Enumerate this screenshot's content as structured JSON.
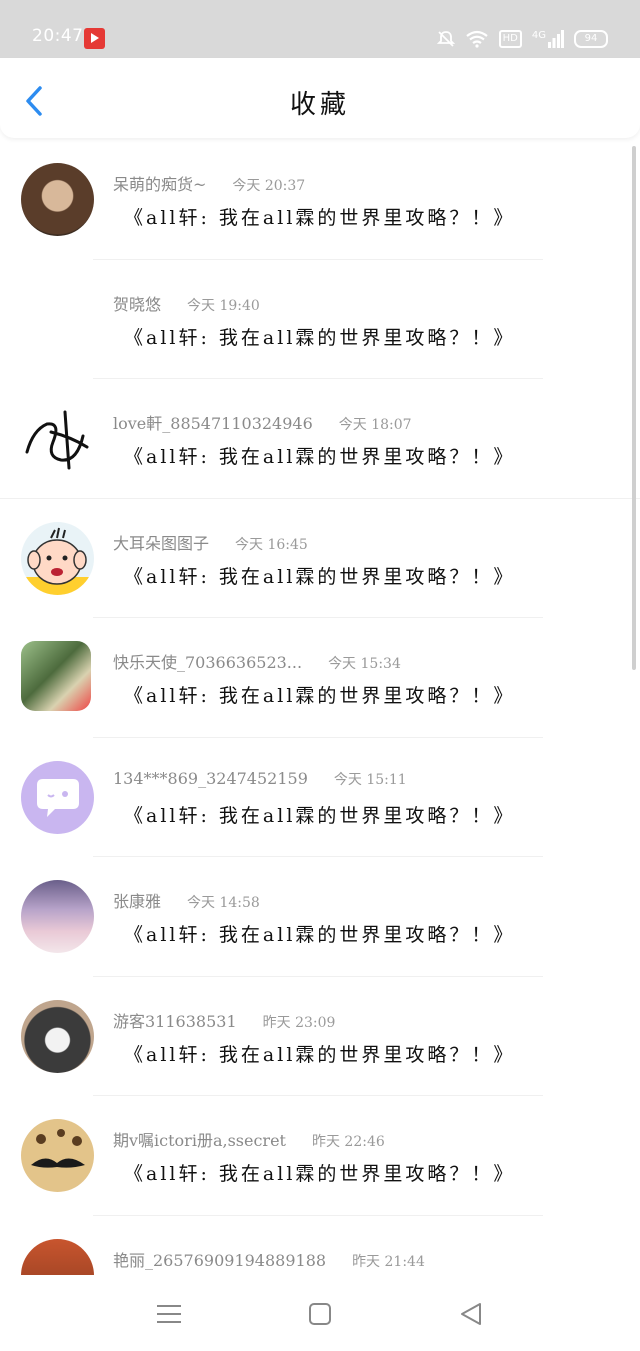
{
  "status_bar": {
    "time": "20:47",
    "hd": "HD",
    "network": "4G",
    "battery": "94"
  },
  "header": {
    "title": "收藏"
  },
  "items": [
    {
      "name": "呆萌的痴货~",
      "time": "今天 20:37",
      "title": "《all轩: 我在all霖的世界里攻略？！》",
      "avatar_color": "#8a6a4a"
    },
    {
      "name": "贺晓悠",
      "time": "今天 19:40",
      "title": "《all轩: 我在all霖的世界里攻略？！》",
      "avatar_color": "#ffffff"
    },
    {
      "name": "love軒_88547110324946",
      "time": "今天 18:07",
      "title": "《all轩: 我在all霖的世界里攻略？！》",
      "avatar_color": "#ffffff"
    },
    {
      "name": "大耳朵图图子",
      "time": "今天 16:45",
      "title": "《all轩: 我在all霖的世界里攻略？！》",
      "avatar_color": "#e9f3f7"
    },
    {
      "name": "快乐天使_7036636523...",
      "time": "今天 15:34",
      "title": "《all轩: 我在all霖的世界里攻略？！》",
      "avatar_color": "#6f8b5a"
    },
    {
      "name": "134***869_3247452159",
      "time": "今天 15:11",
      "title": "《all轩: 我在all霖的世界里攻略？！》",
      "avatar_color": "#c9b6f0"
    },
    {
      "name": "张康雅",
      "time": "今天 14:58",
      "title": "《all轩: 我在all霖的世界里攻略？！》",
      "avatar_color": "#b7a3c9"
    },
    {
      "name": "游客311638531",
      "time": "昨天 23:09",
      "title": "《all轩: 我在all霖的世界里攻略？！》",
      "avatar_color": "#6b6b6b"
    },
    {
      "name": "期v嘱ictori册a,ssecret",
      "time": "昨天 22:46",
      "title": "《all轩: 我在all霖的世界里攻略？！》",
      "avatar_color": "#e3c48a"
    },
    {
      "name": "艳丽_26576909194889188",
      "time": "昨天 21:44",
      "title": "",
      "avatar_color": "#c8552e"
    }
  ]
}
